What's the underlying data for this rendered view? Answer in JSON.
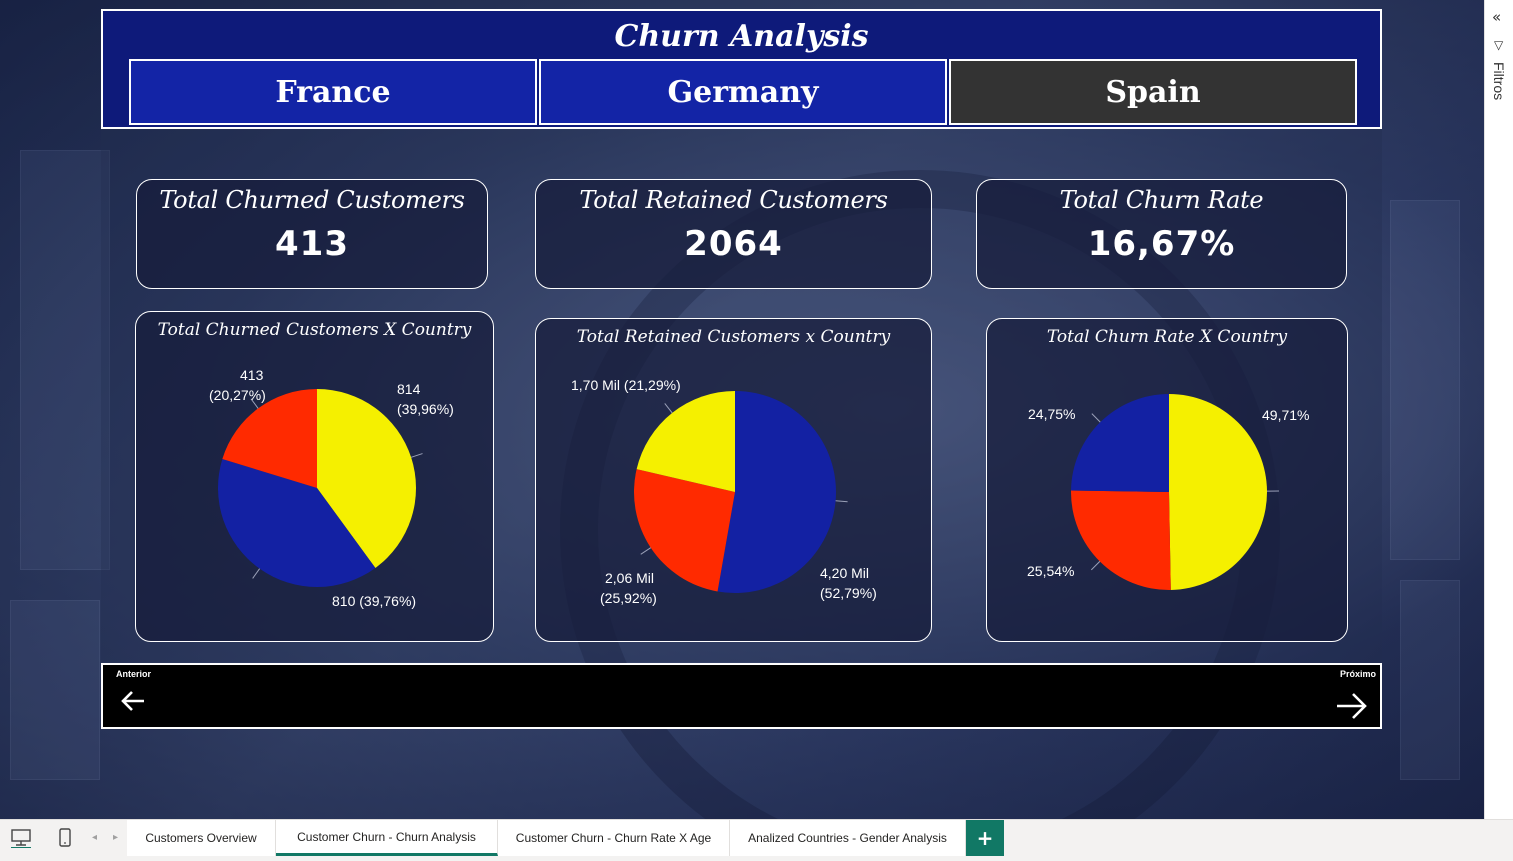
{
  "header": {
    "title": "Churn Analysis",
    "buttons": [
      {
        "label": "France"
      },
      {
        "label": "Germany"
      },
      {
        "label": "Spain"
      }
    ]
  },
  "kpis": [
    {
      "title": "Total Churned Customers",
      "value": "413"
    },
    {
      "title": "Total Retained Customers",
      "value": "2064"
    },
    {
      "title": "Total Churn Rate",
      "value": "16,67%"
    }
  ],
  "colors": {
    "france": "#f5f000",
    "germany": "#ff2a00",
    "spain": "#1321a3",
    "header_bg": "#0e1a7a",
    "selected_button": "#333333",
    "accent": "#117865"
  },
  "pies": [
    {
      "title": "Total Churned Customers X Country",
      "labels": [
        "814",
        "(39,96%)",
        "810 (39,76%)",
        "413",
        "(20,27%)"
      ]
    },
    {
      "title": "Total Retained Customers x Country",
      "labels": [
        "4,20 Mil",
        "(52,79%)",
        "2,06 Mil",
        "(25,92%)",
        "1,70 Mil (21,29%)"
      ]
    },
    {
      "title": "Total Churn Rate X Country",
      "labels": [
        "49,71%",
        "25,54%",
        "24,75%"
      ]
    }
  ],
  "chart_data": [
    {
      "type": "pie",
      "title": "Total Churned Customers X Country",
      "values": [
        814,
        810,
        413
      ],
      "percentages": [
        39.96,
        39.76,
        20.27
      ],
      "colors": [
        "#f5f000",
        "#1321a3",
        "#ff2a00"
      ]
    },
    {
      "type": "pie",
      "title": "Total Retained Customers x Country",
      "values": [
        4200,
        2060,
        1700
      ],
      "percentages": [
        52.79,
        25.92,
        21.29
      ],
      "colors": [
        "#1321a3",
        "#ff2a00",
        "#f5f000"
      ]
    },
    {
      "type": "pie",
      "title": "Total Churn Rate X Country",
      "values": [
        49.71,
        25.54,
        24.75
      ],
      "percentages": [
        49.71,
        25.54,
        24.75
      ],
      "colors": [
        "#f5f000",
        "#ff2a00",
        "#1321a3"
      ]
    }
  ],
  "nav": {
    "previous_label": "Anterior",
    "next_label": "Próximo",
    "previous_icon": "arrow-left-icon",
    "next_icon": "arrow-right-icon"
  },
  "filter_pane": {
    "label": "Filtros",
    "collapse_icon": "double-chevron-left-icon",
    "filter_icon": "funnel-icon"
  },
  "tabs": [
    {
      "label": "Customers Overview",
      "active": false
    },
    {
      "label": "Customer Churn - Churn Analysis",
      "active": true
    },
    {
      "label": "Customer Churn - Churn Rate X Age",
      "active": false
    },
    {
      "label": "Analized Countries - Gender Analysis",
      "active": false
    }
  ],
  "tab_bar": {
    "add_label": "+",
    "desktop_icon": "desktop-icon",
    "mobile_icon": "mobile-icon"
  }
}
